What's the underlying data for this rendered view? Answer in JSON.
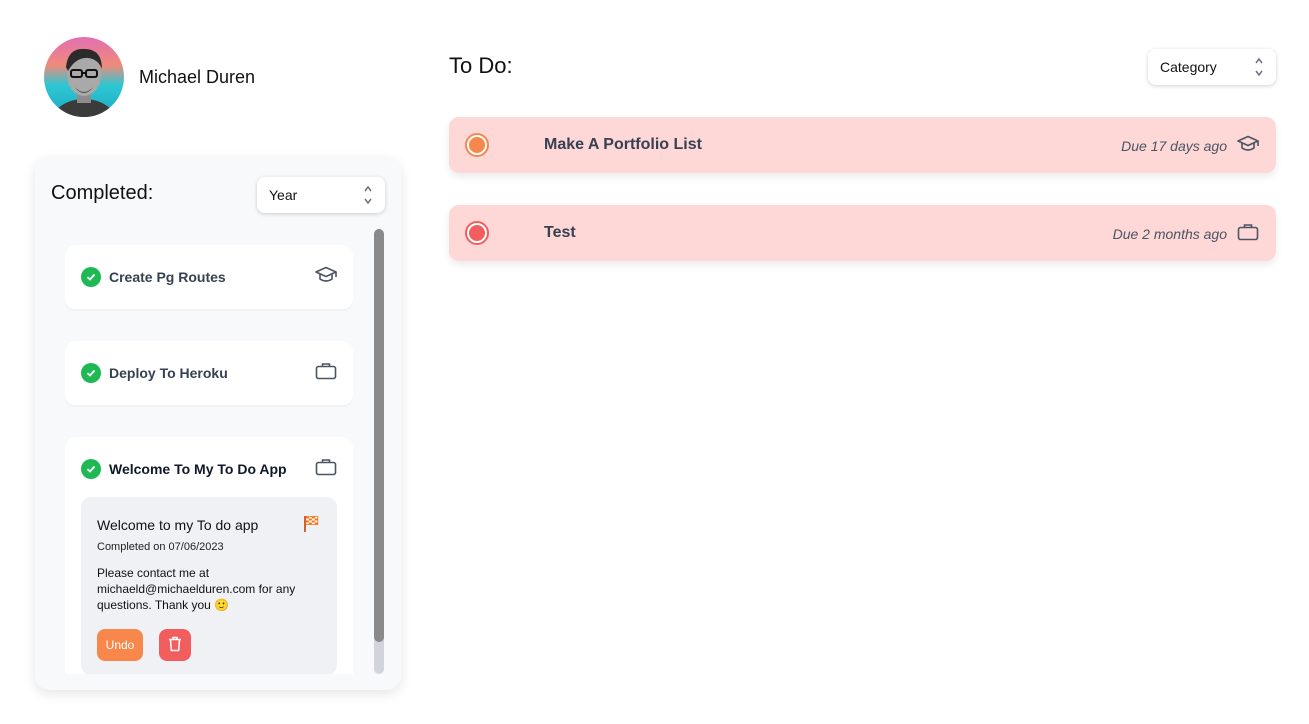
{
  "profile": {
    "name": "Michael Duren"
  },
  "completed": {
    "title": "Completed:",
    "filter": {
      "selected": "Year"
    },
    "items": [
      {
        "title": "Create Pg Routes",
        "icon": "graduation-cap-icon"
      },
      {
        "title": "Deploy To Heroku",
        "icon": "briefcase-icon"
      },
      {
        "title": "Welcome To My To Do App",
        "icon": "briefcase-icon",
        "detail": {
          "title": "Welcome to my To do app",
          "completed_on": "Completed on 07/06/2023",
          "message": "Please contact me at michaeld@michaelduren.com for any questions. Thank you 🙂",
          "priority_icon": "checkered-flag-icon",
          "undo_label": "Undo"
        }
      }
    ]
  },
  "todo": {
    "title": "To Do:",
    "filter": {
      "selected": "Category"
    },
    "items": [
      {
        "title": "Make A Portfolio List",
        "due": "Due 17 days ago",
        "icon": "graduation-cap-icon",
        "status_color": "#f7874b"
      },
      {
        "title": "Test",
        "due": "Due 2 months ago",
        "icon": "briefcase-icon",
        "status_color": "#f25e5e"
      }
    ]
  },
  "colors": {
    "check_green": "#1fb954",
    "todo_card_bg": "#fed7d7",
    "undo_orange": "#f7874b",
    "delete_red": "#f25e5e"
  }
}
